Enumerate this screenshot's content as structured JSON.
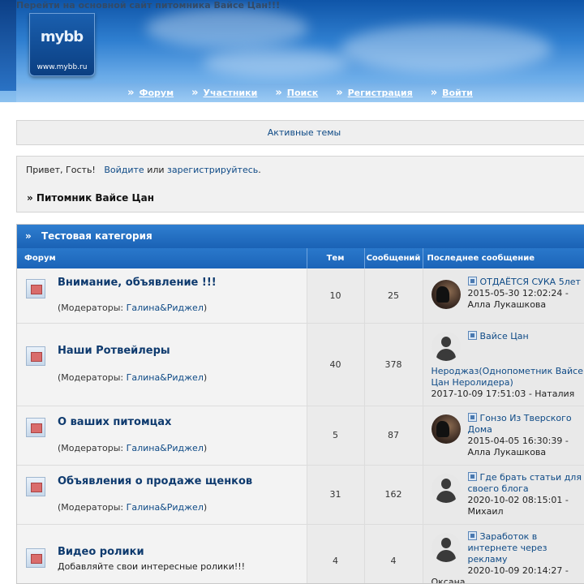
{
  "header": {
    "top_link": "Перейти на основной сайт питомника Вайсе Цан!!!",
    "logo_text": "mybb",
    "logo_url": "www.mybb.ru",
    "nav": [
      {
        "label": "Форум",
        "icon": "double-chevron-icon"
      },
      {
        "label": "Участники",
        "icon": "double-chevron-icon"
      },
      {
        "label": "Поиск",
        "icon": "double-chevron-icon"
      },
      {
        "label": "Регистрация",
        "icon": "double-chevron-icon"
      },
      {
        "label": "Войти",
        "icon": "double-chevron-icon"
      }
    ]
  },
  "active_topics": "Активные темы",
  "welcome": {
    "greeting": "Привет, Гость!",
    "login": "Войдите",
    "or": "или",
    "register": "зарегистрируйтесь",
    "period": ".",
    "breadcrumb": "» Питомник Вайсе Цан"
  },
  "category": {
    "title": "Тестовая категория",
    "columns": {
      "forum": "Форум",
      "topics": "Тем",
      "posts": "Сообщений",
      "last": "Последнее сообщение"
    },
    "forums": [
      {
        "title": "Внимание, объявление !!!",
        "mods_prefix": "(Модераторы:",
        "mods": "Галина&Риджел",
        "mods_suffix": ")",
        "topics": "10",
        "posts": "25",
        "last_topic": "ОТДАЁТСЯ СУКА 5лет",
        "last_date": "2015-05-30 12:02:24 -",
        "last_author": "Алла Лукашкова",
        "avatar": "dog"
      },
      {
        "title": "Наши Ротвейлеры",
        "mods_prefix": "(Модераторы:",
        "mods": "Галина&Риджел",
        "mods_suffix": ")",
        "topics": "40",
        "posts": "378",
        "last_topic_line1": "Вайсе Цан",
        "last_topic_line2": "Нероджаз(Однопометник Вайсе",
        "last_topic_line3": "Цан Неролидера)",
        "last_date": "2017-10-09 17:51:03 - Наталия",
        "avatar": "person"
      },
      {
        "title": "О ваших питомцах",
        "mods_prefix": "(Модераторы:",
        "mods": "Галина&Риджел",
        "mods_suffix": ")",
        "topics": "5",
        "posts": "87",
        "last_topic_line1": "Гонзо Из Тверского",
        "last_topic_line2": "Дома",
        "last_date": "2015-04-05 16:30:39 -",
        "last_author": "Алла Лукашкова",
        "avatar": "dog"
      },
      {
        "title": "Объявления о продаже щенков",
        "mods_prefix": "(Модераторы:",
        "mods": "Галина&Риджел",
        "mods_suffix": ")",
        "topics": "31",
        "posts": "162",
        "last_topic_line1": "Где брать статьи для",
        "last_topic_line2": "своего блога",
        "last_date": "2020-10-02 08:15:01 -",
        "last_author": "Михаил",
        "avatar": "person"
      },
      {
        "title": "Видео ролики",
        "description": "Добавляйте свои интересные ролики!!!",
        "topics": "4",
        "posts": "4",
        "last_topic_line1": "Заработок в",
        "last_topic_line2": "интернете через",
        "last_topic_line3": "рекламу",
        "last_date": "2020-10-09 20:14:27 -",
        "last_author": "Оксана",
        "avatar": "person"
      }
    ]
  }
}
